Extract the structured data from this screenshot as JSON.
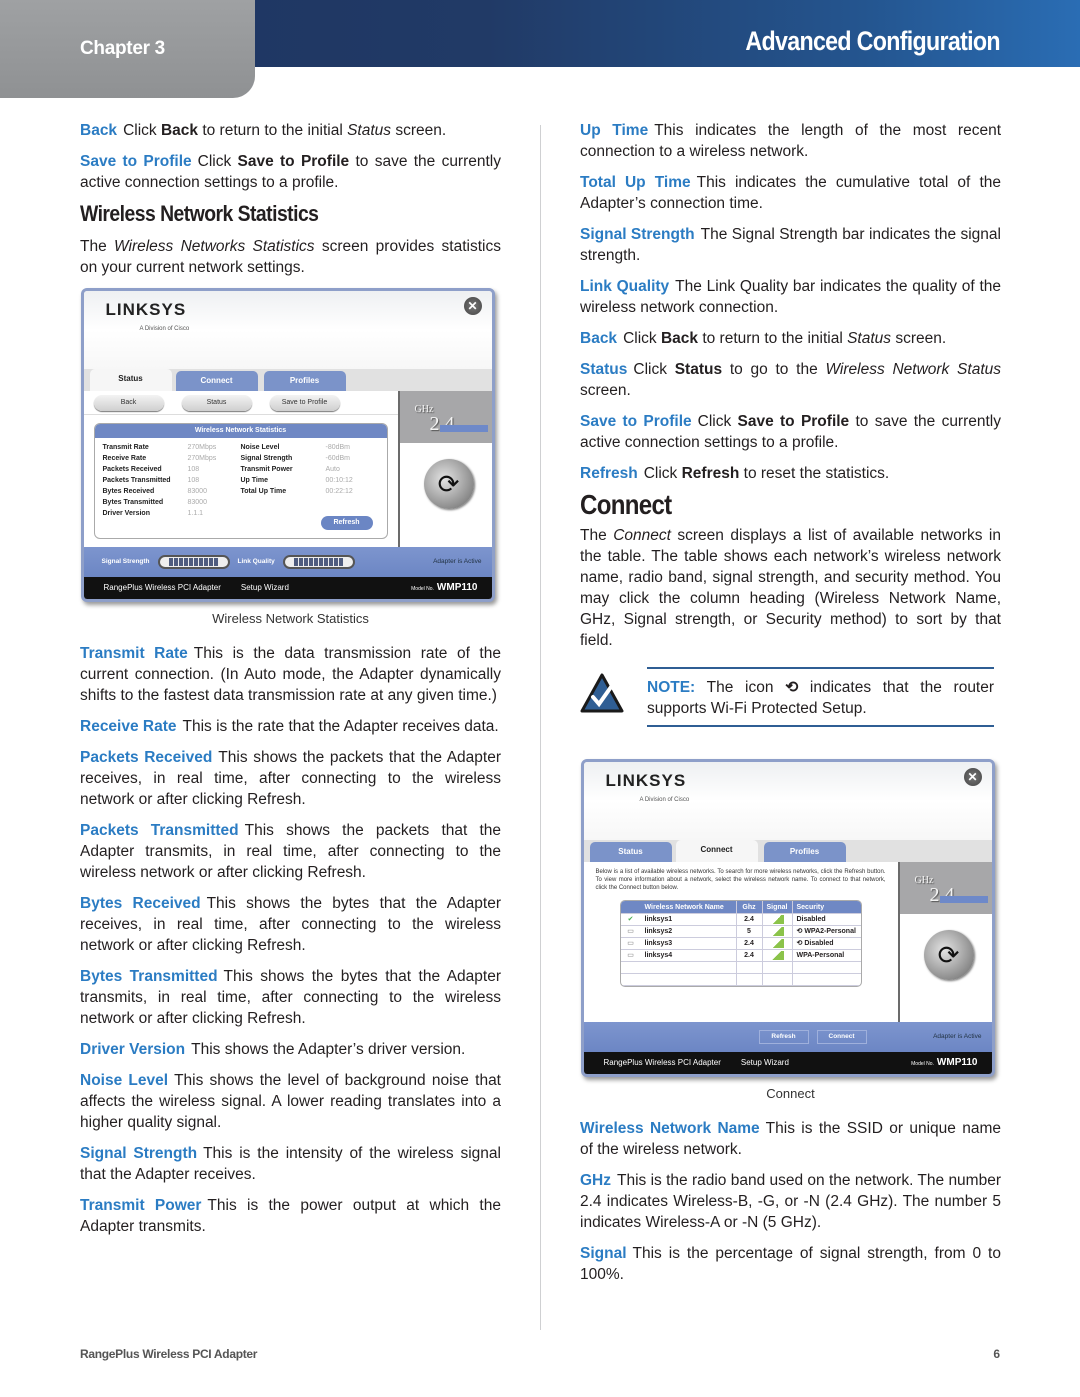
{
  "header": {
    "chapter": "Chapter 3",
    "title": "Advanced Configuration"
  },
  "left_column": {
    "intro_entries": [
      {
        "term": "Back",
        "text_parts": [
          "Click ",
          "Back",
          " to return to the initial ",
          "Status",
          " screen."
        ]
      },
      {
        "term": "Save to Profile",
        "text_parts": [
          "Click ",
          "Save to Profile",
          " to save the currently active connection settings to a profile."
        ]
      }
    ],
    "section_title": "Wireless Network Statistics",
    "section_intro_parts": [
      "The ",
      "Wireless Networks Statistics",
      " screen provides statistics on your current network settings."
    ],
    "figure_caption": "Wireless Network Statistics",
    "entries": [
      {
        "term": "Transmit Rate",
        "text": "This is the data transmission rate of the current connection. (In Auto mode, the Adapter dynamically shifts to the fastest data transmission rate at any given time.)"
      },
      {
        "term": "Receive Rate",
        "text": "This is the rate that the Adapter receives data."
      },
      {
        "term": "Packets Received",
        "text": "This shows the packets that the Adapter receives, in real time, after connecting to the wireless network or after clicking Refresh."
      },
      {
        "term": "Packets Transmitted",
        "text": "This shows the packets that the Adapter transmits, in real time, after connecting to the wireless network or after clicking Refresh."
      },
      {
        "term": "Bytes Received",
        "text": "This shows the bytes that the Adapter receives, in real time, after connecting to the wireless network or after clicking Refresh."
      },
      {
        "term": "Bytes Transmitted",
        "text": "This shows the bytes that the Adapter transmits, in real time, after connecting to the wireless network or after clicking Refresh."
      },
      {
        "term": "Driver Version",
        "text": "This shows the Adapter’s driver version."
      },
      {
        "term": "Noise Level",
        "text": "This shows the level of background noise that affects the wireless signal. A lower reading translates into a higher quality signal."
      },
      {
        "term": "Signal Strength",
        "text": "This is the intensity of the wireless signal that the Adapter receives."
      },
      {
        "term": "Transmit Power",
        "text": "This is the power output at which the Adapter transmits."
      }
    ]
  },
  "stats_window": {
    "logo": "LINKSYS",
    "logo_sub": "A Division of Cisco",
    "tabs": [
      "Status",
      "Connect",
      "Profiles"
    ],
    "active_tab": "Status",
    "buttons": [
      "Back",
      "Status",
      "Save to Profile"
    ],
    "panel_title": "Wireless Network Statistics",
    "left_stats": [
      {
        "label": "Transmit Rate",
        "value": "270Mbps"
      },
      {
        "label": "Receive Rate",
        "value": "270Mbps"
      },
      {
        "label": "Packets Received",
        "value": "108"
      },
      {
        "label": "Packets Transmitted",
        "value": "108"
      },
      {
        "label": "Bytes Received",
        "value": "83000"
      },
      {
        "label": "Bytes Transmitted",
        "value": "83000"
      },
      {
        "label": "Driver Version",
        "value": "1.1.1"
      }
    ],
    "right_stats": [
      {
        "label": "Noise Level",
        "value": "-80dBm"
      },
      {
        "label": "Signal Strength",
        "value": "-60dBm"
      },
      {
        "label": "Transmit Power",
        "value": "Auto"
      },
      {
        "label": "Up Time",
        "value": "00:10:12"
      },
      {
        "label": "Total Up Time",
        "value": "00:22:12"
      }
    ],
    "refresh_label": "Refresh",
    "band": "2.4",
    "band_unit": "GHz",
    "signal_label": "Signal Strength",
    "link_label": "Link Quality",
    "adapter_status": "Adapter is Active",
    "product": "RangePlus Wireless PCI Adapter",
    "setup_wizard": "Setup Wizard",
    "model_prefix": "Model No.",
    "model": "WMP110"
  },
  "right_column": {
    "entries": [
      {
        "term": "Up Time",
        "text": "This indicates the length of the most recent connection to a wireless network."
      },
      {
        "term": "Total Up Time",
        "text": "This indicates the cumulative total of the Adapter’s connection time."
      },
      {
        "term": "Signal Strength",
        "text": "The Signal Strength bar indicates the signal strength."
      },
      {
        "term": "Link Quality",
        "text": "The Link Quality bar indicates the quality of the wireless network connection."
      }
    ],
    "back_entry": {
      "term": "Back",
      "text_parts": [
        "Click ",
        "Back",
        " to return to the initial ",
        "Status",
        " screen."
      ]
    },
    "status_entry": {
      "term": "Status",
      "text_parts": [
        "Click ",
        "Status",
        " to go to the ",
        "Wireless Network Status",
        " screen."
      ]
    },
    "save_entry": {
      "term": "Save to Profile",
      "text_parts": [
        "Click ",
        "Save to Profile",
        " to save the currently active connection settings to a profile."
      ]
    },
    "refresh_entry": {
      "term": "Refresh",
      "text_parts": [
        "Click ",
        "Refresh",
        " to reset the statistics."
      ]
    },
    "section_title": "Connect",
    "section_intro_parts": [
      "The ",
      "Connect",
      " screen displays a list of available networks in the table. The table shows each network’s wireless network name, radio band, signal strength, and security method. You may click the column heading (Wireless Network Name, GHz, Signal strength, or Security method) to sort by that field."
    ],
    "note": {
      "label": "NOTE:",
      "text_before": "The icon",
      "text_after": "indicates that the router supports Wi-Fi Protected Setup."
    },
    "figure_caption": "Connect",
    "entries_after": [
      {
        "term": "Wireless Network Name",
        "text": "This is the SSID or unique name of the wireless network."
      },
      {
        "term": "GHz",
        "text": "This is the radio band used on the network. The number 2.4 indicates Wireless-B, -G, or -N (2.4 GHz). The number 5 indicates Wireless-A or -N (5 GHz)."
      },
      {
        "term": "Signal",
        "text": "This is the percentage of signal strength, from 0 to 100%."
      }
    ]
  },
  "connect_window": {
    "logo": "LINKSYS",
    "logo_sub": "A Division of Cisco",
    "tabs": [
      "Status",
      "Connect",
      "Profiles"
    ],
    "active_tab": "Connect",
    "description": "Below is a list of available wireless networks. To search for more wireless networks, click the Refresh button. To view more information about a network, select the wireless network name. To connect to that network, click the Connect button below.",
    "columns": [
      "Wireless Network Name",
      "Ghz",
      "Signal",
      "Security"
    ],
    "networks": [
      {
        "name": "linksys1",
        "ghz": "2.4",
        "security": "Disabled",
        "wps": false
      },
      {
        "name": "linksys2",
        "ghz": "5",
        "security": "WPA2-Personal",
        "wps": true
      },
      {
        "name": "linksys3",
        "ghz": "2.4",
        "security": "Disabled",
        "wps": true
      },
      {
        "name": "linksys4",
        "ghz": "2.4",
        "security": "WPA-Personal",
        "wps": false
      }
    ],
    "refresh_label": "Refresh",
    "connect_label": "Connect",
    "band": "2.4",
    "band_unit": "GHz",
    "adapter_status": "Adapter is Active",
    "product": "RangePlus Wireless PCI Adapter",
    "setup_wizard": "Setup Wizard",
    "model_prefix": "Model No.",
    "model": "WMP110"
  },
  "footer": {
    "product": "RangePlus Wireless PCI Adapter",
    "page_number": "6"
  }
}
